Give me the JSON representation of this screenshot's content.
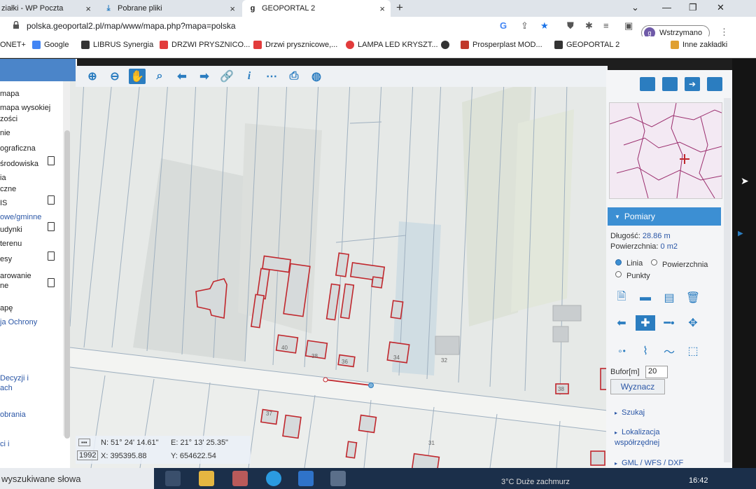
{
  "browser": {
    "tabs": [
      {
        "label": "ziałki - WP Poczta",
        "close": "×"
      },
      {
        "label": "Pobrane pliki",
        "close": "×"
      },
      {
        "label": "GEOPORTAL 2",
        "close": "×"
      }
    ],
    "new_tab": "+",
    "url": "polska.geoportal2.pl/map/www/mapa.php?mapa=polska",
    "profile_label": "Wstrzymano",
    "profile_initial": "g"
  },
  "bookmarks": [
    {
      "label": "ONET+",
      "color": "#e23b3b"
    },
    {
      "label": "Google",
      "color": "#4285f4"
    },
    {
      "label": "LIBRUS Synergia",
      "color": "#333333"
    },
    {
      "label": "DRZWI PRYSZNICO...",
      "color": "#e23b3b"
    },
    {
      "label": "Drzwi prysznicowe,...",
      "color": "#e23b3b"
    },
    {
      "label": "LAMPA LED KRYSZT...",
      "color": "#e23b3b"
    },
    {
      "label": "",
      "color": "#333333"
    },
    {
      "label": "Prosperplast MOD...",
      "color": "#c0392b"
    },
    {
      "label": "GEOPORTAL 2",
      "color": "#333333"
    },
    {
      "label": "Inne zakładki",
      "color": "#e0a030"
    }
  ],
  "sidebar": {
    "items": [
      {
        "label": "mapa",
        "doc": false,
        "blue": false
      },
      {
        "label": "mapa wysokiej",
        "doc": false,
        "blue": false
      },
      {
        "label": "zości",
        "doc": false,
        "blue": false
      },
      {
        "label": "nie",
        "doc": false,
        "blue": false
      },
      {
        "label": "ograficzna",
        "doc": false,
        "blue": false
      },
      {
        "label": "środowiska",
        "doc": true,
        "blue": false
      },
      {
        "label": "ia",
        "doc": false,
        "blue": false
      },
      {
        "label": "czne",
        "doc": false,
        "blue": false
      },
      {
        "label": "IS",
        "doc": true,
        "blue": false
      },
      {
        "label": "owe/gminne",
        "doc": false,
        "blue": true
      },
      {
        "label": "udynki",
        "doc": true,
        "blue": false
      },
      {
        "label": "terenu",
        "doc": false,
        "blue": false
      },
      {
        "label": "esy",
        "doc": true,
        "blue": false
      },
      {
        "label": "arowanie",
        "doc": false,
        "blue": false
      },
      {
        "label": "ne",
        "doc": true,
        "blue": false
      },
      {
        "label": "apę",
        "doc": false,
        "blue": false
      },
      {
        "label": "ja Ochrony",
        "doc": false,
        "blue": true
      },
      {
        "label": "Decyzji i",
        "doc": false,
        "blue": true
      },
      {
        "label": "ach",
        "doc": false,
        "blue": true
      },
      {
        "label": "obrania",
        "doc": false,
        "blue": true
      },
      {
        "label": "ci i",
        "doc": false,
        "blue": true
      }
    ]
  },
  "map": {
    "parcel_numbers": [
      "40",
      "38",
      "36",
      "34",
      "32",
      "37",
      "31",
      "38"
    ],
    "coords": {
      "dms_label": "N: 51° 24' 14.61\"",
      "e_label": "E: 21° 13' 25.35\"",
      "epsg": "1992",
      "x_label": "X: 395395.88",
      "y_label": "Y: 654622.54"
    }
  },
  "panel": {
    "section_title": "Pomiary",
    "length_label": "Długość:",
    "length_value": "28.86 m",
    "area_label": "Powierzchnia:",
    "area_value": "0 m2",
    "mode_options": [
      "Linia",
      "Powierzchnia",
      "Punkty"
    ],
    "mode_selected": "Linia",
    "buffer_label": "Bufor[m]",
    "buffer_value": "20",
    "compute_button": "Wyznacz",
    "links": [
      "Szukaj",
      "Lokalizacja współrzędnej",
      "GML / WFS / DXF"
    ]
  },
  "taskbar": {
    "search_placeholder": "wyszukiwane słowa",
    "weather": "3°C  Duże zachmurz",
    "time": "16:42"
  },
  "colors": {
    "accent": "#3c8fd3",
    "parcel_outline": "#c0272d",
    "map_bg": "#e8ebe9"
  }
}
